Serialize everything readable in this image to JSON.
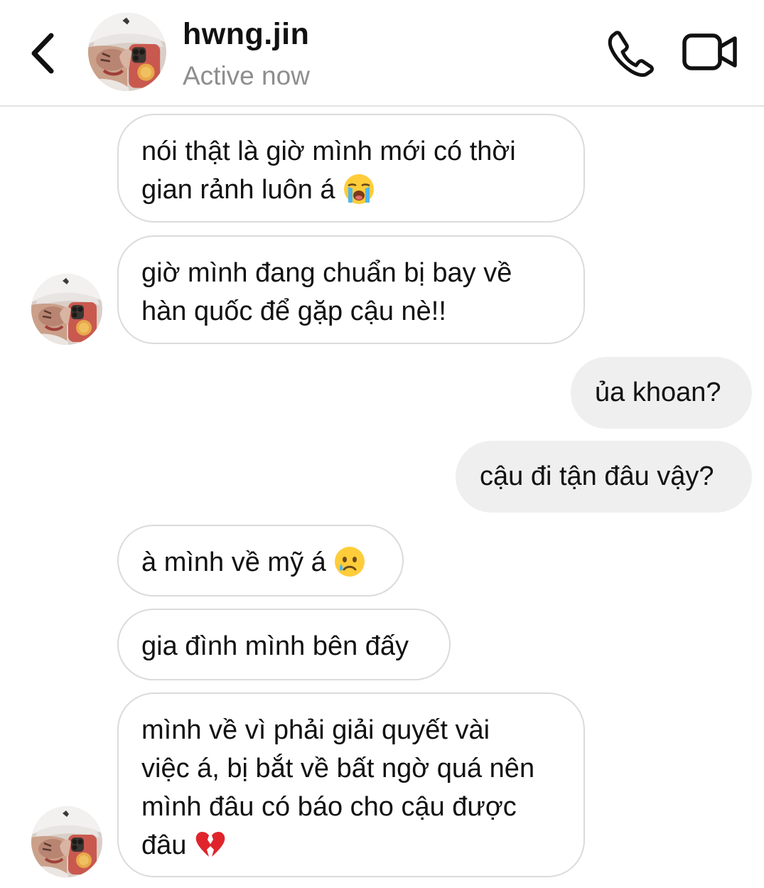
{
  "header": {
    "username": "hwng.jin",
    "status": "Active now",
    "back_icon": "chevron-left-icon",
    "call_icon": "phone-icon",
    "video_icon": "video-camera-icon"
  },
  "messages": [
    {
      "direction": "incoming",
      "lines": [
        "nói thật là giờ mình mới có thời",
        "gian rảnh luôn á"
      ],
      "emoji": "loudly-crying-face-emoji"
    },
    {
      "direction": "incoming",
      "lines": [
        "giờ mình đang chuẩn bị bay về",
        "hàn quốc để gặp cậu nè!!"
      ]
    },
    {
      "direction": "outgoing",
      "lines": [
        "ủa khoan?"
      ]
    },
    {
      "direction": "outgoing",
      "lines": [
        "cậu đi tận đâu vậy?"
      ]
    },
    {
      "direction": "incoming",
      "lines": [
        "à mình về mỹ á"
      ],
      "emoji": "crying-face-emoji"
    },
    {
      "direction": "incoming",
      "lines": [
        "gia đình mình bên đấy"
      ]
    },
    {
      "direction": "incoming",
      "lines": [
        "mình về vì phải giải quyết vài",
        "việc á, bị bắt về bất ngờ quá nên",
        "mình đâu có báo cho cậu được",
        "đâu"
      ],
      "emoji": "broken-heart-emoji"
    }
  ],
  "colors": {
    "incoming_border": "#dbdbdb",
    "outgoing_bg": "#efefef",
    "status_gray": "#8e8e8e",
    "text": "#111111"
  }
}
